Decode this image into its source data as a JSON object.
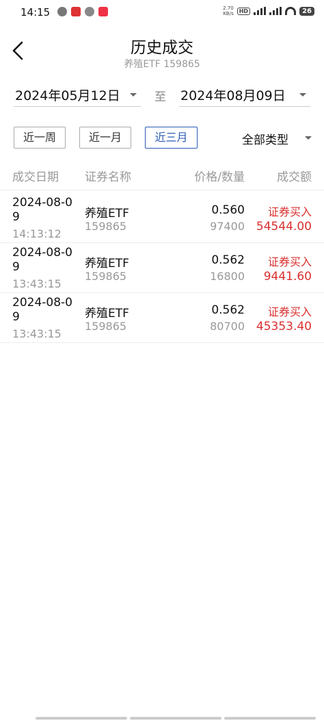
{
  "status_bar": {
    "time": "14:15",
    "net_speed_value": "2.70",
    "net_speed_unit": "KB/s",
    "hd_label": "HD",
    "battery": "26"
  },
  "header": {
    "title": "历史成交",
    "subtitle": "养殖ETF 159865"
  },
  "date_range": {
    "start": "2024年05月12日",
    "separator": "至",
    "end": "2024年08月09日"
  },
  "periods": [
    {
      "label": "近一周",
      "active": false
    },
    {
      "label": "近一月",
      "active": false
    },
    {
      "label": "近三月",
      "active": true
    }
  ],
  "type_filter": {
    "label": "全部类型"
  },
  "table": {
    "columns": [
      "成交日期",
      "证券名称",
      "价格/数量",
      "成交额"
    ],
    "rows": [
      {
        "date_line1": "2024-08-0",
        "date_line2": "9",
        "time": "14:13:12",
        "name": "养殖ETF",
        "code": "159865",
        "price": "0.560",
        "quantity": "97400",
        "type": "证券买入",
        "amount": "54544.00"
      },
      {
        "date_line1": "2024-08-0",
        "date_line2": "9",
        "time": "13:43:15",
        "name": "养殖ETF",
        "code": "159865",
        "price": "0.562",
        "quantity": "16800",
        "type": "证券买入",
        "amount": "9441.60"
      },
      {
        "date_line1": "2024-08-0",
        "date_line2": "9",
        "time": "13:43:15",
        "name": "养殖ETF",
        "code": "159865",
        "price": "0.562",
        "quantity": "80700",
        "type": "证券买入",
        "amount": "45353.40"
      }
    ]
  },
  "colors": {
    "accent": "#2a5bb5",
    "buy": "#d9302e",
    "muted": "#999999"
  }
}
